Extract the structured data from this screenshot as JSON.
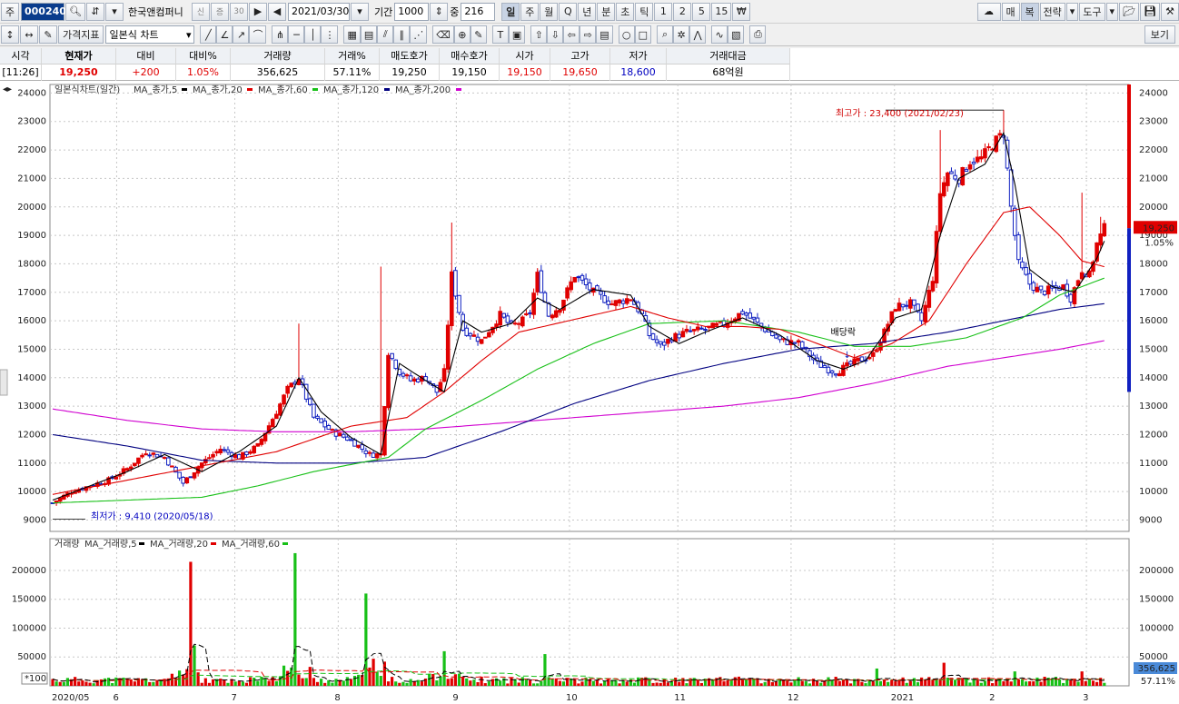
{
  "toolbar1": {
    "type_label": "주",
    "code": "000240",
    "company": "한국앤컴퍼니",
    "badge_credit": "신",
    "badge_margin": "증",
    "badge_30": "30",
    "date": "2021/03/30",
    "period_label": "기간",
    "period_value": "1000",
    "mid_label": "중",
    "mid_value": "216",
    "periods": [
      "일",
      "주",
      "월",
      "Q",
      "년",
      "분",
      "초",
      "틱",
      "1",
      "2",
      "5",
      "15",
      "₩"
    ],
    "right_buttons": [
      "매",
      "복",
      "전략",
      "도구"
    ]
  },
  "toolbar2": {
    "indicator_button": "가격지표",
    "chart_type": "일본식 차트",
    "view_button": "보기"
  },
  "quote": {
    "headers": [
      "시각",
      "현재가",
      "대비",
      "대비%",
      "거래량",
      "거래%",
      "매도호가",
      "매수호가",
      "시가",
      "고가",
      "저가",
      "거래대금"
    ],
    "values": [
      "[11:26]",
      "19,250",
      "+200",
      "1.05%",
      "356,625",
      "57.11%",
      "19,250",
      "19,150",
      "19,150",
      "19,650",
      "18,600",
      "68억원"
    ]
  },
  "price_legend": {
    "title": "일본식차트(일간)",
    "items": [
      {
        "label": "MA_종가,5",
        "color": "#000000"
      },
      {
        "label": "MA_종가,20",
        "color": "#e00000"
      },
      {
        "label": "MA_종가,60",
        "color": "#18c018"
      },
      {
        "label": "MA_종가,120",
        "color": "#000080"
      },
      {
        "label": "MA_종가,200",
        "color": "#d000d0"
      }
    ]
  },
  "volume_legend": {
    "title": "거래량",
    "items": [
      {
        "label": "MA_거래량,5",
        "color": "#000000"
      },
      {
        "label": "MA_거래량,20",
        "color": "#e00000"
      },
      {
        "label": "MA_거래량,60",
        "color": "#18c018"
      }
    ]
  },
  "annotations": {
    "high": "최고가 : 23,400 (2021/02/23)",
    "low": "최저가 : 9,410 (2020/05/18)",
    "dividend": "배당락"
  },
  "price_axis": {
    "ticks": [
      "24000",
      "23000",
      "22000",
      "21000",
      "20000",
      "19000",
      "18000",
      "17000",
      "16000",
      "15000",
      "14000",
      "13000",
      "12000",
      "11000",
      "10000",
      "9000"
    ],
    "current": "19,250",
    "current_pct": "1.05%"
  },
  "volume_axis": {
    "ticks": [
      "200000",
      "150000",
      "100000",
      "50000"
    ],
    "unit": "*100",
    "current": "356,625",
    "current_pct": "57.11%"
  },
  "x_axis": [
    "2020/05",
    "6",
    "7",
    "8",
    "9",
    "10",
    "11",
    "12",
    "2021",
    "2",
    "3"
  ],
  "colors": {
    "up": "#e00000",
    "down": "#1020c0",
    "ma5": "#000000",
    "ma20": "#e00000",
    "ma60": "#18c018",
    "ma120": "#000080",
    "ma200": "#d000d0"
  },
  "chart_data": {
    "type": "candlestick",
    "ylim": [
      8600,
      24300
    ],
    "high": 23400,
    "low": 9410,
    "last": 19250,
    "price_path": [
      [
        0,
        9600
      ],
      [
        5,
        10000
      ],
      [
        10,
        10200
      ],
      [
        15,
        10400
      ],
      [
        20,
        10800
      ],
      [
        25,
        11400
      ],
      [
        30,
        11200
      ],
      [
        35,
        10300
      ],
      [
        40,
        11000
      ],
      [
        45,
        11500
      ],
      [
        50,
        11200
      ],
      [
        55,
        11600
      ],
      [
        60,
        12800
      ],
      [
        63,
        13600
      ],
      [
        66,
        14000
      ],
      [
        70,
        12600
      ],
      [
        75,
        12100
      ],
      [
        80,
        11800
      ],
      [
        85,
        11300
      ],
      [
        88,
        11300
      ],
      [
        90,
        14900
      ],
      [
        93,
        14200
      ],
      [
        96,
        13900
      ],
      [
        100,
        14000
      ],
      [
        103,
        13500
      ],
      [
        105,
        14200
      ],
      [
        107,
        17600
      ],
      [
        110,
        15700
      ],
      [
        115,
        15300
      ],
      [
        120,
        16200
      ],
      [
        123,
        15800
      ],
      [
        126,
        16000
      ],
      [
        128,
        16300
      ],
      [
        130,
        17600
      ],
      [
        133,
        16200
      ],
      [
        136,
        16500
      ],
      [
        140,
        17600
      ],
      [
        145,
        17000
      ],
      [
        150,
        16600
      ],
      [
        155,
        16800
      ],
      [
        158,
        16200
      ],
      [
        160,
        15500
      ],
      [
        163,
        15100
      ],
      [
        166,
        15400
      ],
      [
        170,
        15600
      ],
      [
        175,
        15700
      ],
      [
        180,
        15900
      ],
      [
        185,
        16300
      ],
      [
        190,
        15800
      ],
      [
        195,
        15300
      ],
      [
        200,
        15200
      ],
      [
        205,
        14500
      ],
      [
        208,
        14300
      ],
      [
        210,
        14200
      ],
      [
        213,
        14400
      ],
      [
        216,
        14600
      ],
      [
        220,
        14800
      ],
      [
        223,
        15600
      ],
      [
        226,
        16500
      ],
      [
        230,
        16600
      ],
      [
        233,
        16000
      ],
      [
        236,
        17500
      ],
      [
        238,
        20500
      ],
      [
        240,
        21200
      ],
      [
        243,
        21000
      ],
      [
        246,
        21600
      ],
      [
        249,
        21700
      ],
      [
        252,
        22200
      ],
      [
        255,
        22600
      ],
      [
        257,
        20000
      ],
      [
        259,
        18000
      ],
      [
        262,
        17300
      ],
      [
        265,
        17000
      ],
      [
        268,
        17100
      ],
      [
        271,
        17200
      ],
      [
        273,
        16800
      ],
      [
        276,
        17800
      ],
      [
        278,
        17600
      ],
      [
        280,
        18700
      ],
      [
        282,
        19250
      ]
    ],
    "ma5": [
      [
        0,
        9700
      ],
      [
        10,
        10200
      ],
      [
        20,
        10700
      ],
      [
        30,
        11300
      ],
      [
        40,
        10700
      ],
      [
        50,
        11400
      ],
      [
        60,
        12300
      ],
      [
        66,
        14000
      ],
      [
        72,
        12800
      ],
      [
        80,
        11900
      ],
      [
        88,
        11300
      ],
      [
        93,
        14500
      ],
      [
        100,
        13900
      ],
      [
        105,
        13500
      ],
      [
        110,
        16000
      ],
      [
        115,
        15600
      ],
      [
        123,
        15900
      ],
      [
        130,
        16800
      ],
      [
        136,
        16400
      ],
      [
        145,
        17100
      ],
      [
        155,
        16900
      ],
      [
        160,
        15800
      ],
      [
        168,
        15200
      ],
      [
        175,
        15600
      ],
      [
        185,
        16100
      ],
      [
        195,
        15500
      ],
      [
        205,
        14600
      ],
      [
        212,
        14300
      ],
      [
        218,
        14600
      ],
      [
        226,
        16100
      ],
      [
        233,
        16400
      ],
      [
        238,
        19000
      ],
      [
        243,
        21000
      ],
      [
        250,
        21500
      ],
      [
        255,
        22600
      ],
      [
        258,
        20800
      ],
      [
        262,
        17800
      ],
      [
        268,
        17200
      ],
      [
        274,
        17000
      ],
      [
        280,
        18200
      ],
      [
        282,
        18800
      ]
    ],
    "ma20": [
      [
        0,
        9900
      ],
      [
        20,
        10400
      ],
      [
        40,
        10900
      ],
      [
        60,
        11400
      ],
      [
        80,
        12300
      ],
      [
        95,
        12600
      ],
      [
        105,
        13500
      ],
      [
        115,
        14600
      ],
      [
        125,
        15600
      ],
      [
        135,
        15900
      ],
      [
        145,
        16200
      ],
      [
        155,
        16500
      ],
      [
        165,
        16100
      ],
      [
        175,
        15800
      ],
      [
        185,
        15800
      ],
      [
        195,
        15700
      ],
      [
        205,
        15200
      ],
      [
        215,
        14700
      ],
      [
        225,
        15200
      ],
      [
        235,
        16000
      ],
      [
        245,
        18000
      ],
      [
        255,
        19800
      ],
      [
        262,
        20000
      ],
      [
        270,
        19000
      ],
      [
        276,
        18100
      ],
      [
        282,
        17900
      ]
    ],
    "ma60": [
      [
        0,
        9600
      ],
      [
        20,
        9700
      ],
      [
        40,
        9800
      ],
      [
        55,
        10200
      ],
      [
        70,
        10700
      ],
      [
        90,
        11200
      ],
      [
        100,
        12200
      ],
      [
        115,
        13200
      ],
      [
        130,
        14300
      ],
      [
        145,
        15200
      ],
      [
        160,
        15900
      ],
      [
        180,
        16000
      ],
      [
        200,
        15600
      ],
      [
        215,
        15100
      ],
      [
        230,
        15100
      ],
      [
        245,
        15400
      ],
      [
        260,
        16100
      ],
      [
        270,
        16900
      ],
      [
        282,
        17500
      ]
    ],
    "ma120": [
      [
        0,
        12000
      ],
      [
        20,
        11600
      ],
      [
        40,
        11100
      ],
      [
        60,
        11000
      ],
      [
        80,
        11000
      ],
      [
        100,
        11200
      ],
      [
        120,
        12100
      ],
      [
        140,
        13100
      ],
      [
        160,
        13900
      ],
      [
        180,
        14500
      ],
      [
        200,
        15000
      ],
      [
        220,
        15200
      ],
      [
        240,
        15600
      ],
      [
        255,
        16000
      ],
      [
        270,
        16400
      ],
      [
        282,
        16600
      ]
    ],
    "ma200": [
      [
        0,
        12900
      ],
      [
        20,
        12500
      ],
      [
        40,
        12200
      ],
      [
        60,
        12100
      ],
      [
        80,
        12100
      ],
      [
        100,
        12200
      ],
      [
        120,
        12400
      ],
      [
        140,
        12600
      ],
      [
        160,
        12800
      ],
      [
        180,
        13000
      ],
      [
        200,
        13300
      ],
      [
        220,
        13800
      ],
      [
        240,
        14400
      ],
      [
        255,
        14700
      ],
      [
        270,
        15000
      ],
      [
        282,
        15300
      ]
    ],
    "volume_spikes": [
      [
        37,
        2150
      ],
      [
        38,
        700
      ],
      [
        65,
        2300
      ],
      [
        84,
        1600
      ],
      [
        105,
        600
      ],
      [
        132,
        550
      ],
      [
        221,
        300
      ],
      [
        239,
        400
      ],
      [
        258,
        250
      ],
      [
        276,
        250
      ]
    ],
    "volume_ylim": [
      0,
      2500
    ]
  }
}
